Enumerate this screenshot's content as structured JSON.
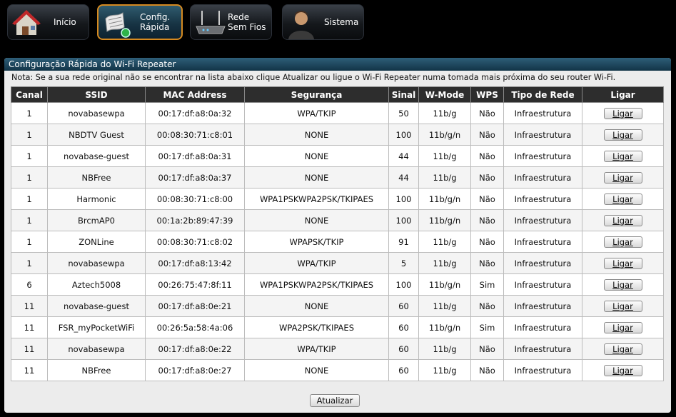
{
  "nav": {
    "items": [
      {
        "label_line1": "Início",
        "label_line2": ""
      },
      {
        "label_line1": "Config.",
        "label_line2": "Rápida"
      },
      {
        "label_line1": "Rede",
        "label_line2": "Sem Fios"
      },
      {
        "label_line1": "Sistema",
        "label_line2": ""
      }
    ],
    "active_index": 1,
    "accent": "#d68a20"
  },
  "panel": {
    "title": "Configuração Rápida do Wi-Fi Repeater",
    "note": "Nota: Se a sua rede original não se encontrar na lista abaixo clique Atualizar ou ligue o Wi-Fi Repeater numa tomada mais próxima do seu router Wi-Fi."
  },
  "table": {
    "headers": [
      "Canal",
      "SSID",
      "MAC Address",
      "Segurança",
      "Sinal",
      "W-Mode",
      "WPS",
      "Tipo de Rede",
      "Ligar"
    ],
    "rows": [
      {
        "canal": "1",
        "ssid": "novabasewpa",
        "mac": "00:17:df:a8:0a:32",
        "seguranca": "WPA/TKIP",
        "sinal": "50",
        "wmode": "11b/g",
        "wps": "Não",
        "tipo": "Infraestrutura",
        "ligar": "Ligar"
      },
      {
        "canal": "1",
        "ssid": "NBDTV Guest",
        "mac": "00:08:30:71:c8:01",
        "seguranca": "NONE",
        "sinal": "100",
        "wmode": "11b/g/n",
        "wps": "Não",
        "tipo": "Infraestrutura",
        "ligar": "Ligar"
      },
      {
        "canal": "1",
        "ssid": "novabase-guest",
        "mac": "00:17:df:a8:0a:31",
        "seguranca": "NONE",
        "sinal": "44",
        "wmode": "11b/g",
        "wps": "Não",
        "tipo": "Infraestrutura",
        "ligar": "Ligar"
      },
      {
        "canal": "1",
        "ssid": "NBFree",
        "mac": "00:17:df:a8:0a:37",
        "seguranca": "NONE",
        "sinal": "44",
        "wmode": "11b/g",
        "wps": "Não",
        "tipo": "Infraestrutura",
        "ligar": "Ligar"
      },
      {
        "canal": "1",
        "ssid": "Harmonic",
        "mac": "00:08:30:71:c8:00",
        "seguranca": "WPA1PSKWPA2PSK/TKIPAES",
        "sinal": "100",
        "wmode": "11b/g/n",
        "wps": "Não",
        "tipo": "Infraestrutura",
        "ligar": "Ligar"
      },
      {
        "canal": "1",
        "ssid": "BrcmAP0",
        "mac": "00:1a:2b:89:47:39",
        "seguranca": "NONE",
        "sinal": "100",
        "wmode": "11b/g/n",
        "wps": "Não",
        "tipo": "Infraestrutura",
        "ligar": "Ligar"
      },
      {
        "canal": "1",
        "ssid": "ZONLine",
        "mac": "00:08:30:71:c8:02",
        "seguranca": "WPAPSK/TKIP",
        "sinal": "91",
        "wmode": "11b/g",
        "wps": "Não",
        "tipo": "Infraestrutura",
        "ligar": "Ligar"
      },
      {
        "canal": "1",
        "ssid": "novabasewpa",
        "mac": "00:17:df:a8:13:42",
        "seguranca": "WPA/TKIP",
        "sinal": "5",
        "wmode": "11b/g",
        "wps": "Não",
        "tipo": "Infraestrutura",
        "ligar": "Ligar"
      },
      {
        "canal": "6",
        "ssid": "Aztech5008",
        "mac": "00:26:75:47:8f:11",
        "seguranca": "WPA1PSKWPA2PSK/TKIPAES",
        "sinal": "100",
        "wmode": "11b/g/n",
        "wps": "Sim",
        "tipo": "Infraestrutura",
        "ligar": "Ligar"
      },
      {
        "canal": "11",
        "ssid": "novabase-guest",
        "mac": "00:17:df:a8:0e:21",
        "seguranca": "NONE",
        "sinal": "60",
        "wmode": "11b/g",
        "wps": "Não",
        "tipo": "Infraestrutura",
        "ligar": "Ligar"
      },
      {
        "canal": "11",
        "ssid": "FSR_myPocketWiFi",
        "mac": "00:26:5a:58:4a:06",
        "seguranca": "WPA2PSK/TKIPAES",
        "sinal": "60",
        "wmode": "11b/g/n",
        "wps": "Sim",
        "tipo": "Infraestrutura",
        "ligar": "Ligar"
      },
      {
        "canal": "11",
        "ssid": "novabasewpa",
        "mac": "00:17:df:a8:0e:22",
        "seguranca": "WPA/TKIP",
        "sinal": "60",
        "wmode": "11b/g",
        "wps": "Não",
        "tipo": "Infraestrutura",
        "ligar": "Ligar"
      },
      {
        "canal": "11",
        "ssid": "NBFree",
        "mac": "00:17:df:a8:0e:27",
        "seguranca": "NONE",
        "sinal": "60",
        "wmode": "11b/g",
        "wps": "Não",
        "tipo": "Infraestrutura",
        "ligar": "Ligar"
      }
    ]
  },
  "actions": {
    "refresh_label": "Atualizar"
  }
}
